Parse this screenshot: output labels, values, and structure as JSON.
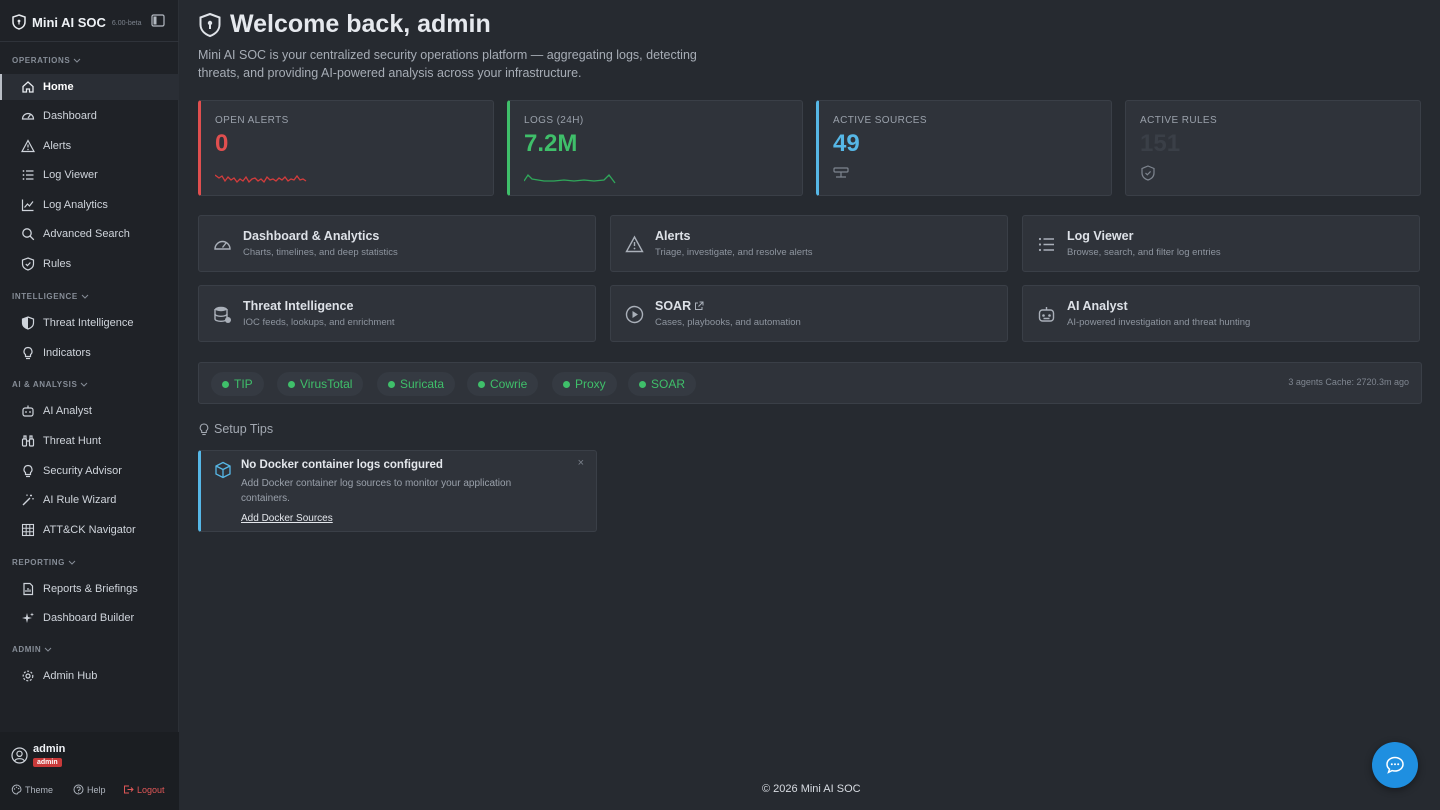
{
  "brand": {
    "name": "Mini AI SOC",
    "version": "6.00-beta"
  },
  "sidebar": {
    "sections": [
      {
        "label": "OPERATIONS"
      },
      {
        "label": "INTELLIGENCE"
      },
      {
        "label": "AI & ANALYSIS"
      },
      {
        "label": "REPORTING"
      },
      {
        "label": "ADMIN"
      }
    ],
    "items": [
      {
        "label": "Home",
        "icon": "home-icon",
        "active": true
      },
      {
        "label": "Dashboard",
        "icon": "gauge-icon"
      },
      {
        "label": "Alerts",
        "icon": "warning-icon"
      },
      {
        "label": "Log Viewer",
        "icon": "list-icon"
      },
      {
        "label": "Log Analytics",
        "icon": "chart-line-icon"
      },
      {
        "label": "Advanced Search",
        "icon": "search-icon"
      },
      {
        "label": "Rules",
        "icon": "shield-check-icon"
      },
      {
        "label": "Threat Intelligence",
        "icon": "shield-half-icon"
      },
      {
        "label": "Indicators",
        "icon": "bulb-icon"
      },
      {
        "label": "AI Analyst",
        "icon": "robot-icon"
      },
      {
        "label": "Threat Hunt",
        "icon": "binoculars-icon"
      },
      {
        "label": "Security Advisor",
        "icon": "bulb-icon"
      },
      {
        "label": "AI Rule Wizard",
        "icon": "magic-wand-icon"
      },
      {
        "label": "ATT&CK Navigator",
        "icon": "grid-icon"
      },
      {
        "label": "Reports & Briefings",
        "icon": "report-icon"
      },
      {
        "label": "Dashboard Builder",
        "icon": "sparkle-icon"
      },
      {
        "label": "Admin Hub",
        "icon": "gear-icon"
      }
    ]
  },
  "user": {
    "name": "admin",
    "role": "admin"
  },
  "footer_actions": {
    "theme": "Theme",
    "help": "Help",
    "logout": "Logout"
  },
  "main": {
    "title": "Welcome back, admin",
    "subtitle": "Mini AI SOC is your centralized security operations platform — aggregating logs, detecting threats, and providing AI-powered analysis across your infrastructure."
  },
  "stats": [
    {
      "label": "OPEN ALERTS",
      "value": "0",
      "color": "#e04f4f"
    },
    {
      "label": "LOGS (24H)",
      "value": "7.2M",
      "color": "#3fbf6a"
    },
    {
      "label": "ACTIVE SOURCES",
      "value": "49",
      "color": "#56b7e6"
    },
    {
      "label": "ACTIVE RULES",
      "value": "151",
      "color": "#3a3f47"
    }
  ],
  "cards": [
    {
      "title": "Dashboard & Analytics",
      "desc": "Charts, timelines, and deep statistics",
      "icon": "gauge-icon"
    },
    {
      "title": "Alerts",
      "desc": "Triage, investigate, and resolve alerts",
      "icon": "warning-icon"
    },
    {
      "title": "Log Viewer",
      "desc": "Browse, search, and filter log entries",
      "icon": "list-icon"
    },
    {
      "title": "Threat Intelligence",
      "desc": "IOC feeds, lookups, and enrichment",
      "icon": "database-icon"
    },
    {
      "title": "SOAR",
      "desc": "Cases, playbooks, and automation",
      "icon": "play-circle-icon",
      "external": true
    },
    {
      "title": "AI Analyst",
      "desc": "AI-powered investigation and threat hunting",
      "icon": "robot-icon"
    }
  ],
  "integrations": {
    "items": [
      "TIP",
      "VirusTotal",
      "Suricata",
      "Cowrie",
      "Proxy",
      "SOAR"
    ],
    "status_color": "#3fbf6a",
    "cache_text": "3 agents Cache: 2720.3m ago"
  },
  "tips": {
    "heading": "Setup Tips",
    "items": [
      {
        "title": "No Docker container logs configured",
        "desc": "Add Docker container log sources to monitor your application containers.",
        "link": "Add Docker Sources",
        "close": "×"
      }
    ]
  },
  "copyright": "© 2026 Mini AI SOC"
}
